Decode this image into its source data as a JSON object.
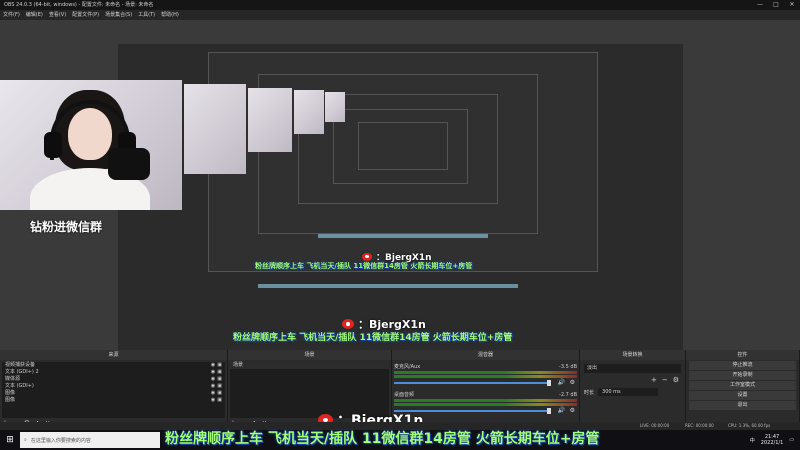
{
  "window": {
    "title": "OBS 24.0.3 (64-bit, windows) - 配置文件: 未命名 - 场景: 未命名"
  },
  "window_controls": {
    "minimize": "—",
    "maximize": "□",
    "close": "✕"
  },
  "menu": [
    "文件(F)",
    "编辑(E)",
    "查看(V)",
    "配置文件(P)",
    "场景集合(S)",
    "工具(T)",
    "帮助(H)"
  ],
  "preview": {
    "cam_caption": "钻粉进微信群",
    "weibo_handle": "：BjergX1n",
    "banner": "粉丝牌顺序上车 飞机当天/插队 11微信群14房管 火箭长期车位+房管"
  },
  "docks": {
    "sources": {
      "title": "来源",
      "items": [
        "视频捕获设备",
        "文本 (GDI+) 2",
        "媒体源",
        "文本 (GDI+)",
        "图像",
        "图像"
      ]
    },
    "scenes": {
      "title": "场景",
      "items": [
        "场景"
      ]
    },
    "mixer": {
      "title": "混音器",
      "tracks": [
        {
          "name": "麦克风/Aux",
          "db": "-3.5 dB"
        },
        {
          "name": "桌面音频",
          "db": "-2.7 dB"
        }
      ]
    },
    "transitions": {
      "title": "场景转换",
      "type": "淡出",
      "duration_label": "时长",
      "duration_value": "300 ms"
    },
    "controls": {
      "title": "控件",
      "buttons": [
        "停止推流",
        "开始录制",
        "工作室模式",
        "设置",
        "退出"
      ]
    }
  },
  "toolbar_icons": {
    "add": "+",
    "remove": "−",
    "settings": "⚙",
    "up": "∧",
    "down": "∨"
  },
  "status": {
    "live": "LIVE: 00:00:00",
    "rec": "REC: 00:00:00",
    "cpu": "CPU: 1.3%, 60.00 fps"
  },
  "taskbar": {
    "search_placeholder": "在这里输入你要搜索的内容",
    "time": "21:47",
    "date": "2022/1/1",
    "ime": "中"
  },
  "colors": {
    "banner_text": "#a4ff7a",
    "weibo_red": "#e0241f",
    "meter_green": "#2a7a2a",
    "slider_blue": "#4a8fd8"
  }
}
